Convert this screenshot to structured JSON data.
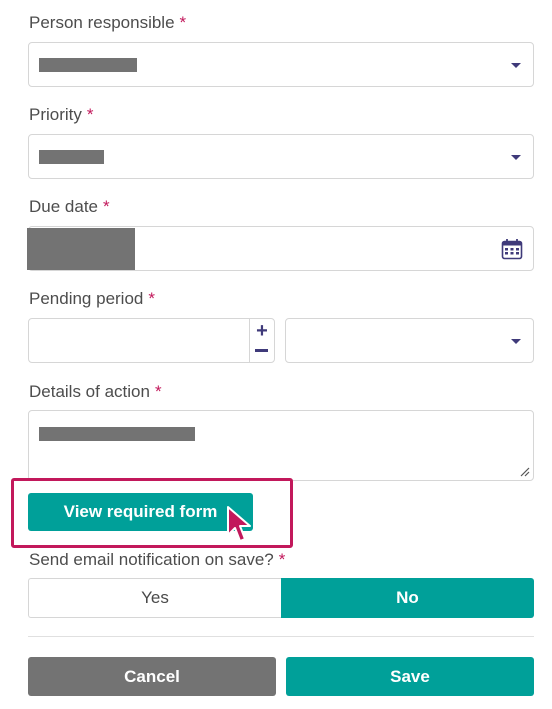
{
  "colors": {
    "accent": "#00a099",
    "required_asterisk": "#c2185b",
    "cancel_bg": "#737373",
    "highlight_frame": "#c2185b",
    "icon": "#3f3a7a"
  },
  "form": {
    "person_responsible": {
      "label": "Person responsible",
      "required_mark": "*",
      "icon": "chevron-down-icon"
    },
    "priority": {
      "label": "Priority",
      "required_mark": "*",
      "icon": "chevron-down-icon"
    },
    "due_date": {
      "label": "Due date",
      "required_mark": "*",
      "icon": "calendar-icon"
    },
    "pending_period": {
      "label": "Pending period",
      "required_mark": "*",
      "stepper_icons": [
        "plus-icon",
        "minus-icon"
      ],
      "unit_icon": "chevron-down-icon"
    },
    "details_of_action": {
      "label": "Details of action",
      "required_mark": "*",
      "icon": "resize-handle-icon"
    },
    "view_required_form": {
      "label": "View required form"
    },
    "send_email_notification": {
      "label": "Send email notification on save?",
      "required_mark": "*",
      "options": [
        {
          "label": "Yes",
          "selected": false
        },
        {
          "label": "No",
          "selected": true
        }
      ]
    }
  },
  "actions": {
    "cancel_label": "Cancel",
    "save_label": "Save"
  }
}
